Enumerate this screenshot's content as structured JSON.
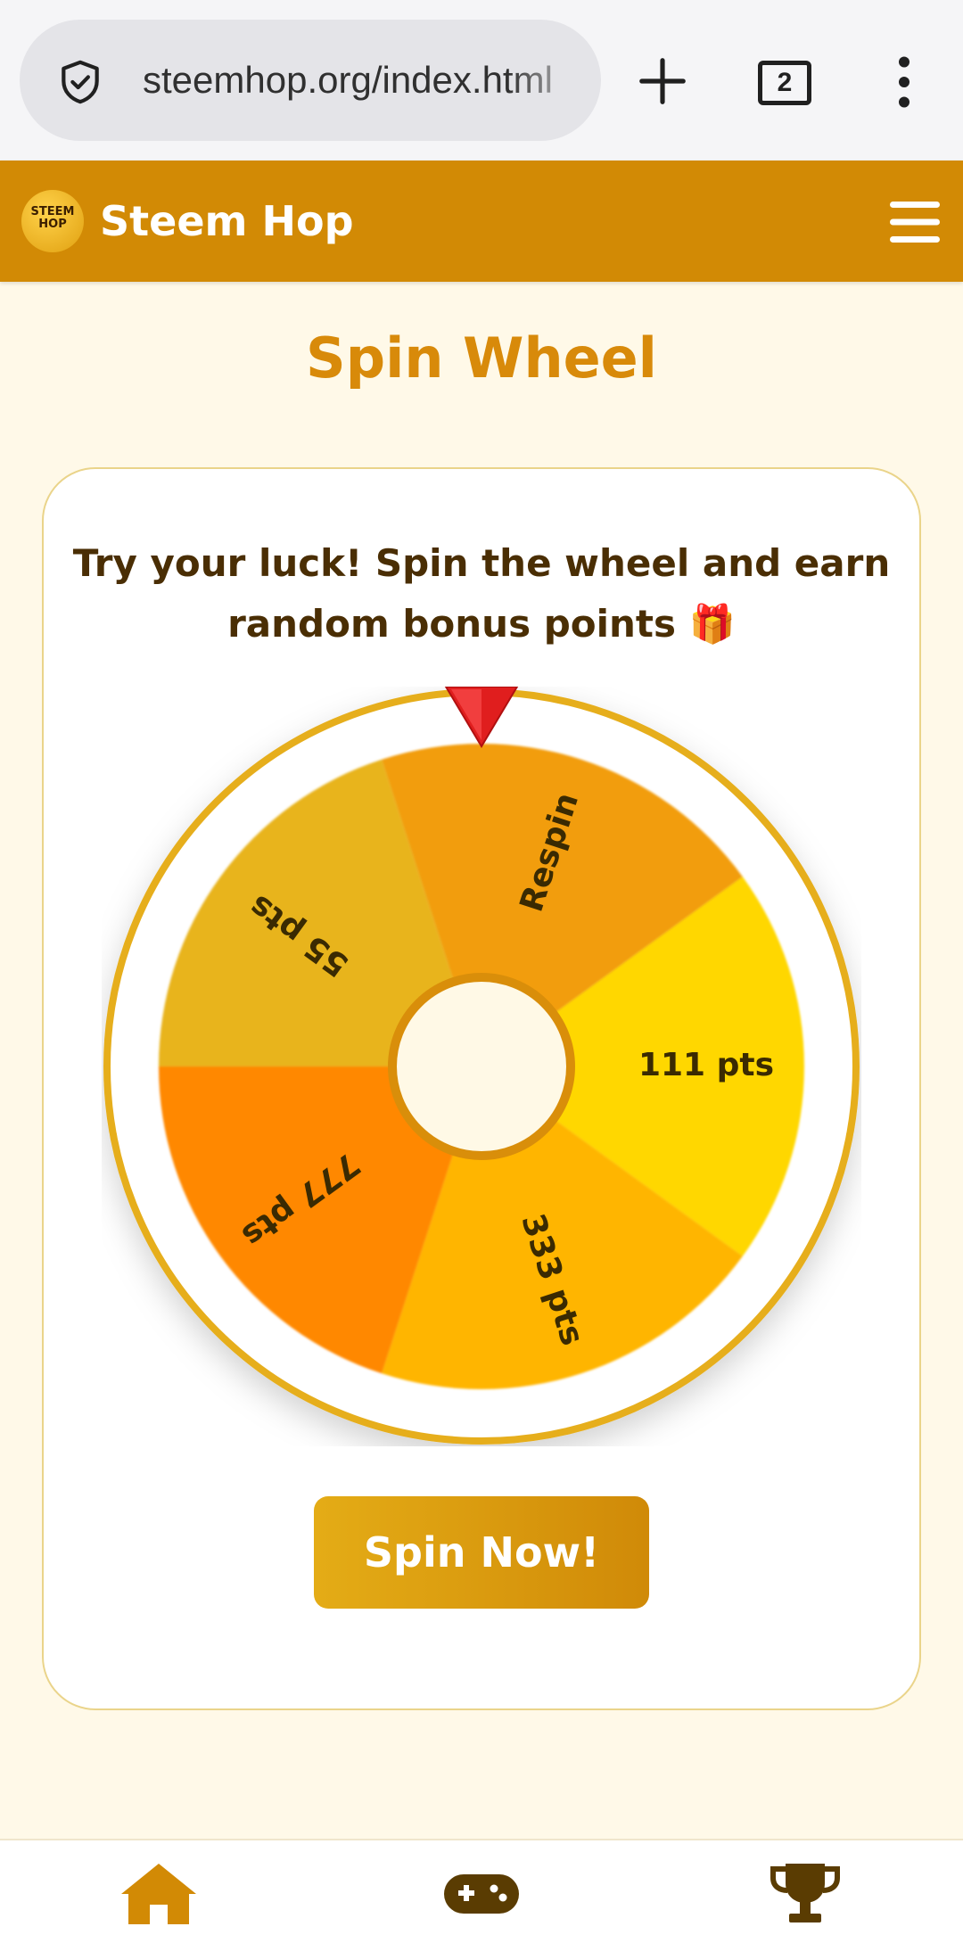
{
  "browser": {
    "url": "steemhop.org/index.html",
    "tab_count": "2",
    "icons": [
      "shield-check-icon",
      "plus-icon",
      "tab-count",
      "more-vertical-icon"
    ]
  },
  "header": {
    "logo_text": "STEEM HOP",
    "brand_name": "Steem Hop",
    "menu_icon": "hamburger-icon"
  },
  "page": {
    "title": "Spin Wheel",
    "subtitle": "Try your luck! Spin the wheel and earn random bonus points 🎁"
  },
  "wheel": {
    "segments": [
      {
        "label": "Respin",
        "color": "#F29D10"
      },
      {
        "label": "111 pts",
        "color": "#FFD700"
      },
      {
        "label": "333 pts",
        "color": "#FFB502"
      },
      {
        "label": "777 pts",
        "color": "#FF8800"
      },
      {
        "label": "55 pts",
        "color": "#E8B41D"
      }
    ],
    "rim_color": "#E6AE1E",
    "hub_color": "#FFF9E6",
    "pointer_color": "#E01E1E"
  },
  "actions": {
    "spin_label": "Spin Now!"
  },
  "bottom_nav": {
    "items": [
      {
        "icon": "home-icon"
      },
      {
        "icon": "gamepad-icon"
      },
      {
        "icon": "trophy-icon"
      }
    ],
    "color": "#D28A05"
  }
}
